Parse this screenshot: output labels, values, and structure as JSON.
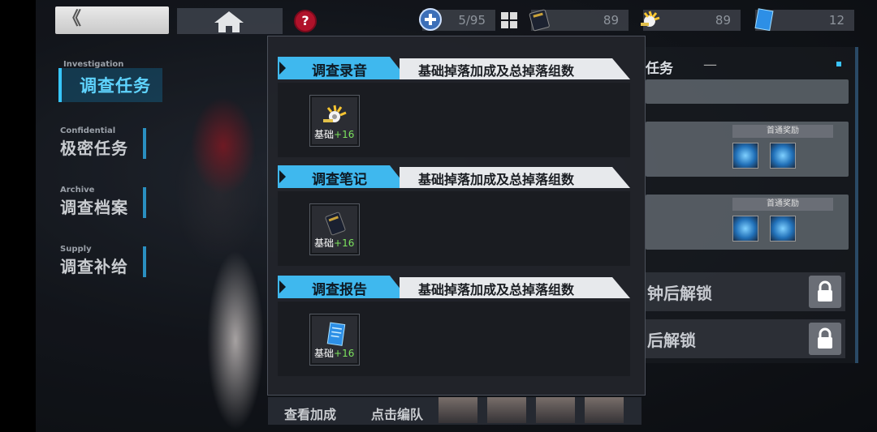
{
  "topbar": {
    "back_label": "《",
    "help_label": "?",
    "resources": [
      {
        "name": "stamina",
        "icon": "plus-circle-icon",
        "value": "5/95"
      },
      {
        "name": "investigation-note",
        "icon": "notebook-icon",
        "value": "89"
      },
      {
        "name": "investigation-recording",
        "icon": "recording-icon",
        "value": "89"
      },
      {
        "name": "investigation-report",
        "icon": "report-icon",
        "value": "12"
      }
    ]
  },
  "nav": {
    "items": [
      {
        "sub": "Investigation",
        "label": "调查任务",
        "active": true
      },
      {
        "sub": "Confidential",
        "label": "极密任务"
      },
      {
        "sub": "Archive",
        "label": "调查档案"
      },
      {
        "sub": "Supply",
        "label": "调查补给"
      }
    ]
  },
  "right_panel": {
    "title": "任务",
    "dash": "—",
    "badge": "首通奖励",
    "lock_rows": [
      {
        "text": "钟后解锁"
      },
      {
        "text": "后解锁"
      }
    ]
  },
  "bottom": {
    "view_bonus": "查看加成",
    "edit_team": "点击编队"
  },
  "modal": {
    "sections": [
      {
        "tab": "调查录音",
        "desc": "基础掉落加成及总掉落组数",
        "item": {
          "icon": "recording-icon",
          "base": "基础",
          "bonus": "+16"
        }
      },
      {
        "tab": "调查笔记",
        "desc": "基础掉落加成及总掉落组数",
        "item": {
          "icon": "notebook-icon",
          "base": "基础",
          "bonus": "+16"
        }
      },
      {
        "tab": "调查报告",
        "desc": "基础掉落加成及总掉落组数",
        "item": {
          "icon": "report-icon",
          "base": "基础",
          "bonus": "+16"
        }
      }
    ]
  },
  "colors": {
    "accent": "#3fb8ee",
    "bonus_green": "#7ce35e",
    "help_red": "#b0122a"
  }
}
